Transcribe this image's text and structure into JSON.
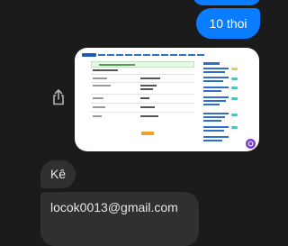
{
  "messages": {
    "outgoing_text": "10 thoi",
    "incoming_short": "Kê",
    "incoming_email": "locok0013@gmail.com"
  },
  "icons": {
    "share": "share-icon",
    "badge": "chat-badge-icon"
  },
  "colors": {
    "background": "#1b1b1b",
    "outgoing_bubble": "#0a7cff",
    "incoming_bubble": "#303030",
    "text": "#e4e6eb"
  }
}
